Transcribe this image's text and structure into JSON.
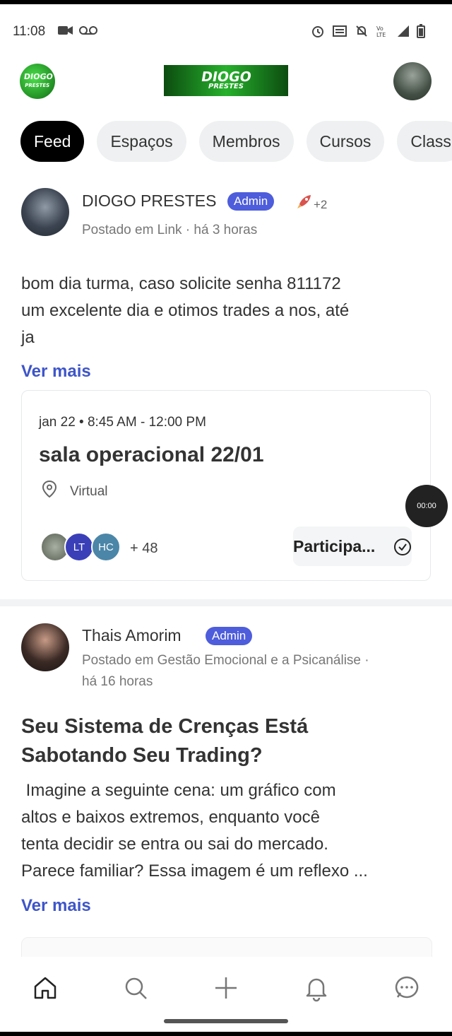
{
  "status_bar": {
    "time": "11:08"
  },
  "header": {
    "logo_line1": "DIOGO",
    "logo_line2": "PRESTES",
    "banner_line1": "DIOGO",
    "banner_line2": "PRESTES"
  },
  "tabs": [
    {
      "label": "Feed",
      "active": true
    },
    {
      "label": "Espaços"
    },
    {
      "label": "Membros"
    },
    {
      "label": "Cursos"
    },
    {
      "label": "Class"
    }
  ],
  "post1": {
    "author": "DIOGO PRESTES",
    "badge": "Admin",
    "reactions": "+2",
    "meta": "Postado em Link · há 3 horas",
    "body_lines": [
      "bom dia turma, caso solicite senha 811172",
      "um excelente dia e otimos trades a nos, até",
      "ja"
    ],
    "more": "Ver mais",
    "event": {
      "date": "jan 22 • 8:45 AM - 12:00 PM",
      "title": "sala operacional 22/01",
      "location": "Virtual",
      "attendees": [
        {
          "initials": "LT",
          "color": "#3a3fb8"
        },
        {
          "initials": "HC",
          "color": "#4b86a8"
        }
      ],
      "count": "+ 48",
      "join_label": "Participa..."
    }
  },
  "timer": "00:00",
  "post2": {
    "author": "Thais Amorim",
    "badge": "Admin",
    "meta_line1": "Postado em Gestão Emocional e a Psicanálise ·",
    "meta_line2": "há 16 horas",
    "title": "Seu Sistema de Crenças Está Sabotando Seu Trading?",
    "body_lines": [
      " Imagine a seguinte cena: um gráfico com",
      "altos e baixos extremos, enquanto você",
      "tenta decidir se entra ou sai do mercado.",
      "Parece familiar? Essa imagem é um reflexo ..."
    ],
    "more": "Ver mais"
  },
  "bottom_nav": [
    "home-icon",
    "search-icon",
    "plus-icon",
    "bell-icon",
    "chat-icon"
  ]
}
